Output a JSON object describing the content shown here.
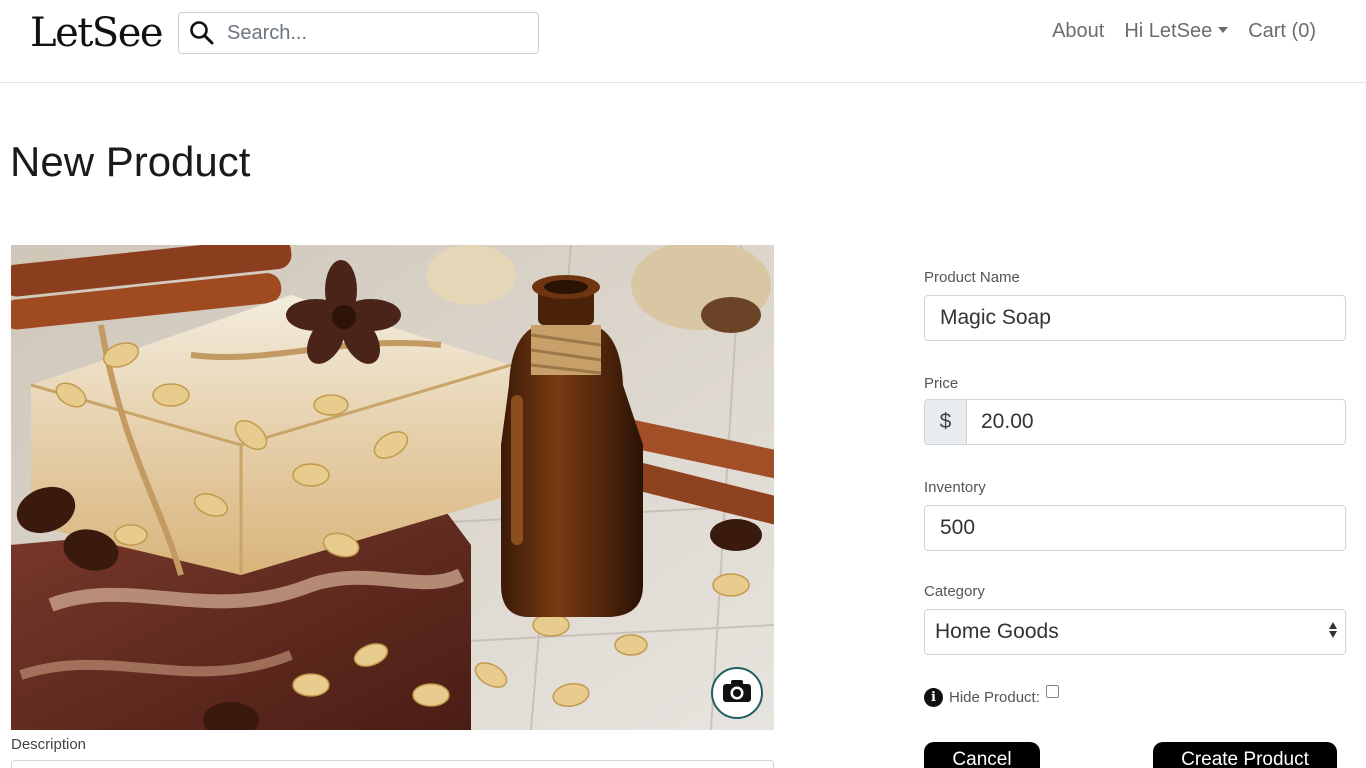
{
  "header": {
    "logo": "LetSee",
    "search_placeholder": "Search...",
    "nav": {
      "about": "About",
      "user_menu": "Hi LetSee",
      "cart": "Cart (0)"
    }
  },
  "page": {
    "title": "New Product"
  },
  "image": {
    "alt": "product image",
    "upload_icon": "camera-icon"
  },
  "description": {
    "label": "Description"
  },
  "form": {
    "product_name": {
      "label": "Product Name",
      "value": "Magic Soap"
    },
    "price": {
      "label": "Price",
      "prefix": "$",
      "value": "20.00"
    },
    "inventory": {
      "label": "Inventory",
      "value": "500"
    },
    "category": {
      "label": "Category",
      "value": "Home Goods"
    },
    "hide_product": {
      "label": "Hide Product:",
      "checked": false,
      "icon": "info-icon"
    }
  },
  "buttons": {
    "cancel": "Cancel",
    "create": "Create Product"
  },
  "colors": {
    "button_bg": "#000000",
    "text_muted": "#6c6c6c",
    "border": "#ced4da"
  }
}
